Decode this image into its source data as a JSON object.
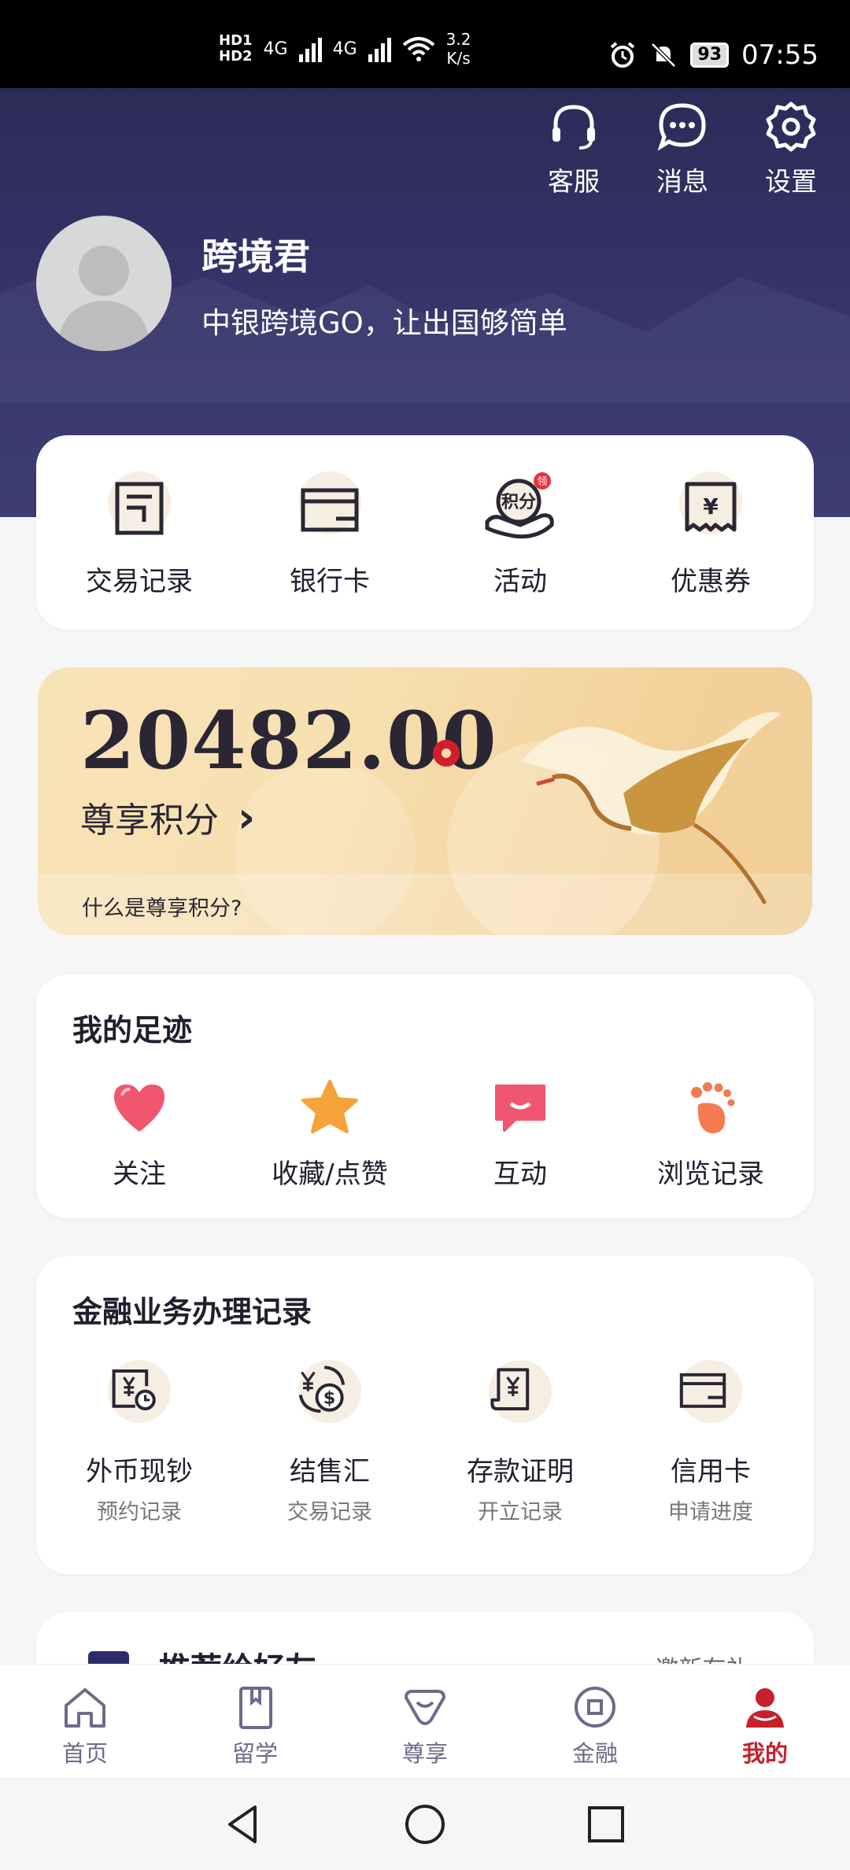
{
  "status_bar": {
    "hd1": "HD1",
    "hd2": "HD2",
    "net1": "4G",
    "net2": "4G",
    "speed_value": "3.2",
    "speed_unit": "K/s",
    "battery": "93",
    "time": "07:55"
  },
  "header": {
    "actions": [
      {
        "label": "客服",
        "icon": "headset-icon"
      },
      {
        "label": "消息",
        "icon": "chat-icon"
      },
      {
        "label": "设置",
        "icon": "gear-icon"
      }
    ],
    "username": "跨境君",
    "slogan": "中银跨境GO，让出国够简单"
  },
  "quick_entries": [
    {
      "label": "交易记录",
      "icon": "receipt-icon"
    },
    {
      "label": "银行卡",
      "icon": "wallet-icon"
    },
    {
      "label": "活动",
      "icon": "points-icon",
      "badge": "领",
      "icon_text": "积分"
    },
    {
      "label": "优惠券",
      "icon": "coupon-icon",
      "icon_text": "¥"
    }
  ],
  "points": {
    "value": "20482.00",
    "label": "尊享积分",
    "arrow": "›",
    "question": "什么是尊享积分?"
  },
  "footprints": {
    "title": "我的足迹",
    "items": [
      {
        "label": "关注",
        "icon": "heart-icon",
        "color": "#f0566e"
      },
      {
        "label": "收藏/点赞",
        "icon": "star-icon",
        "color": "#f5a33a"
      },
      {
        "label": "互动",
        "icon": "message-icon",
        "color": "#f0566e"
      },
      {
        "label": "浏览记录",
        "icon": "footprint-icon",
        "color": "#f47a52"
      }
    ]
  },
  "finance": {
    "title": "金融业务办理记录",
    "items": [
      {
        "label": "外币现钞",
        "sub": "预约记录",
        "icon": "cash-clock-icon"
      },
      {
        "label": "结售汇",
        "sub": "交易记录",
        "icon": "exchange-icon"
      },
      {
        "label": "存款证明",
        "sub": "开立记录",
        "icon": "deposit-certificate-icon"
      },
      {
        "label": "信用卡",
        "sub": "申请进度",
        "icon": "credit-card-icon"
      }
    ]
  },
  "recommend": {
    "title": "推荐给好友",
    "more": "邀新有礼 ›"
  },
  "bottom_nav": [
    {
      "label": "首页",
      "icon": "home-icon",
      "active": false
    },
    {
      "label": "留学",
      "icon": "book-icon",
      "active": false
    },
    {
      "label": "尊享",
      "icon": "crown-icon",
      "active": false
    },
    {
      "label": "金融",
      "icon": "coin-icon",
      "active": false
    },
    {
      "label": "我的",
      "icon": "user-icon",
      "active": true
    }
  ],
  "colors": {
    "header_bg": "#2f2e5e",
    "accent_red": "#c8202b",
    "points_gold": "#f3d19a"
  }
}
